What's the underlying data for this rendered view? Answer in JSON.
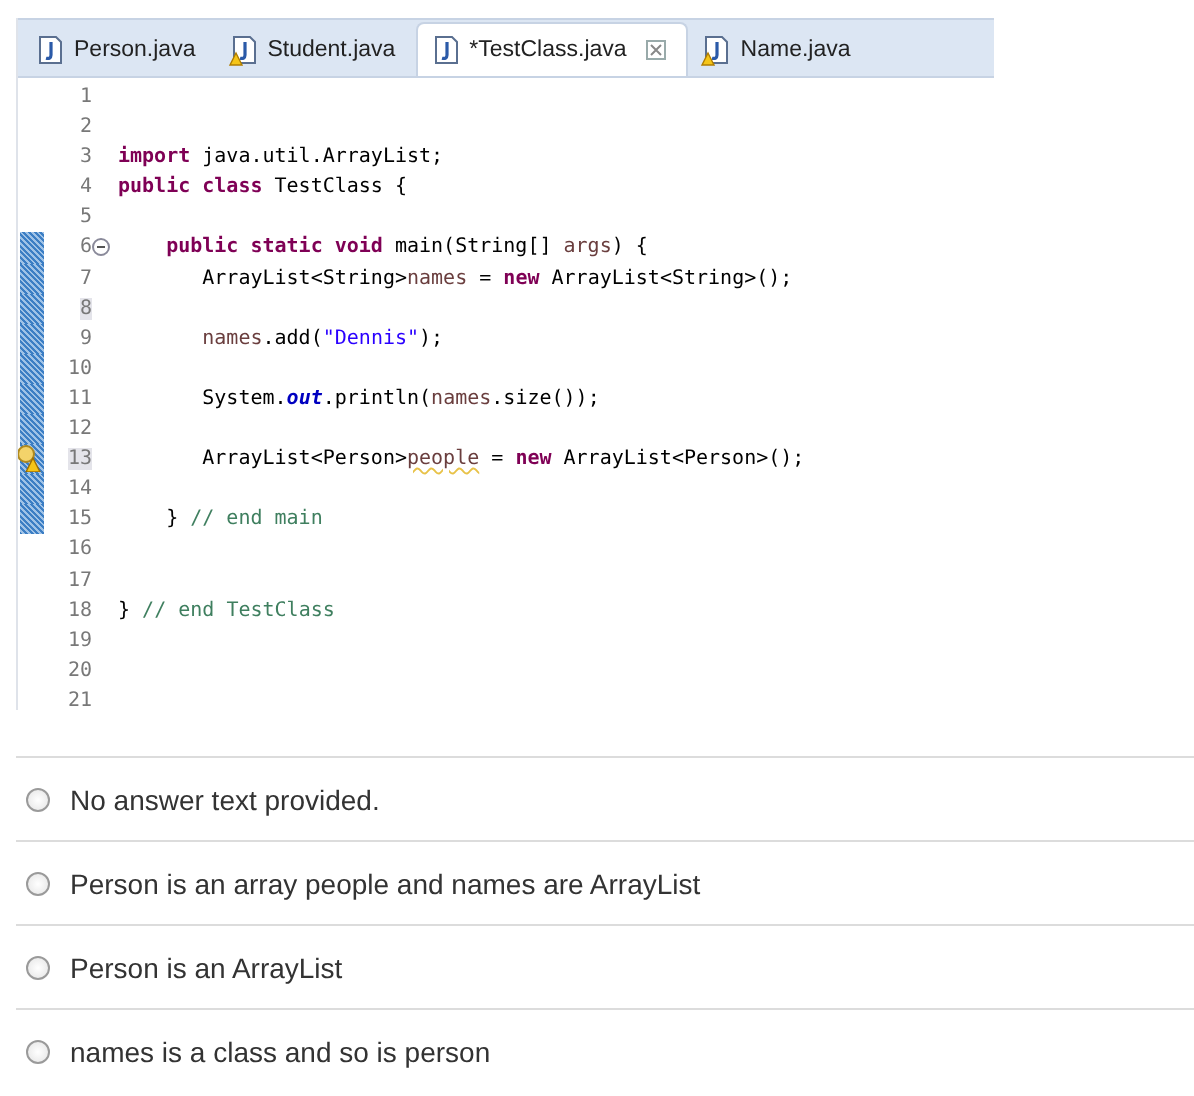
{
  "editor": {
    "tabs": [
      {
        "label": "Person.java",
        "selected": false,
        "warning": false,
        "closable": false
      },
      {
        "label": "Student.java",
        "selected": false,
        "warning": true,
        "closable": false
      },
      {
        "label": "*TestClass.java",
        "selected": true,
        "warning": false,
        "closable": true
      },
      {
        "label": "Name.java",
        "selected": false,
        "warning": true,
        "closable": false
      }
    ],
    "lines": [
      {
        "number": "1",
        "changed": false,
        "fold": false,
        "warning": false,
        "current": false
      },
      {
        "number": "2",
        "changed": false,
        "fold": false,
        "warning": false,
        "current": false
      },
      {
        "number": "3",
        "changed": false,
        "fold": false,
        "warning": false,
        "current": false,
        "tokens": [
          {
            "kind": "keyword",
            "text": "import"
          },
          {
            "kind": "plain",
            "text": " java.util.ArrayList;"
          }
        ]
      },
      {
        "number": "4",
        "changed": false,
        "fold": false,
        "warning": false,
        "current": false,
        "tokens": [
          {
            "kind": "keyword",
            "text": "public class"
          },
          {
            "kind": "plain",
            "text": " TestClass {"
          }
        ]
      },
      {
        "number": "5",
        "changed": false,
        "fold": false,
        "warning": false,
        "current": false
      },
      {
        "number": "6",
        "changed": true,
        "fold": true,
        "warning": false,
        "current": false,
        "tokens": [
          {
            "kind": "keyword",
            "text": "    public static void"
          },
          {
            "kind": "plain",
            "text": " main(String[] "
          },
          {
            "kind": "param",
            "text": "args"
          },
          {
            "kind": "plain",
            "text": ") {"
          }
        ]
      },
      {
        "number": "7",
        "changed": true,
        "fold": false,
        "warning": false,
        "current": false,
        "tokens": [
          {
            "kind": "plain",
            "text": "       ArrayList<String>"
          },
          {
            "kind": "local",
            "text": "names"
          },
          {
            "kind": "plain",
            "text": " = "
          },
          {
            "kind": "keyword",
            "text": "new"
          },
          {
            "kind": "plain",
            "text": " ArrayList<String>();"
          }
        ]
      },
      {
        "number": "8",
        "changed": true,
        "fold": false,
        "warning": false,
        "current": true
      },
      {
        "number": "9",
        "changed": true,
        "fold": false,
        "warning": false,
        "current": false,
        "tokens": [
          {
            "kind": "local",
            "text": "       names"
          },
          {
            "kind": "plain",
            "text": ".add("
          },
          {
            "kind": "string",
            "text": "\"Dennis\""
          },
          {
            "kind": "plain",
            "text": ");"
          }
        ]
      },
      {
        "number": "10",
        "changed": true,
        "fold": false,
        "warning": false,
        "current": false
      },
      {
        "number": "11",
        "changed": true,
        "fold": false,
        "warning": false,
        "current": false,
        "tokens": [
          {
            "kind": "plain",
            "text": "       System."
          },
          {
            "kind": "field",
            "text": "out"
          },
          {
            "kind": "plain",
            "text": ".println("
          },
          {
            "kind": "local",
            "text": "names"
          },
          {
            "kind": "plain",
            "text": ".size());"
          }
        ]
      },
      {
        "number": "12",
        "changed": true,
        "fold": false,
        "warning": false,
        "current": false
      },
      {
        "number": "13",
        "changed": true,
        "fold": false,
        "warning": true,
        "current": true,
        "tokens": [
          {
            "kind": "plain",
            "text": "       ArrayList<Person>"
          },
          {
            "kind": "unused",
            "text": "people"
          },
          {
            "kind": "plain",
            "text": " = "
          },
          {
            "kind": "keyword",
            "text": "new"
          },
          {
            "kind": "plain",
            "text": " ArrayList<Person>();"
          }
        ]
      },
      {
        "number": "14",
        "changed": true,
        "fold": false,
        "warning": false,
        "current": false
      },
      {
        "number": "15",
        "changed": true,
        "fold": false,
        "warning": false,
        "current": false,
        "tokens": [
          {
            "kind": "plain",
            "text": "    } "
          },
          {
            "kind": "comment",
            "text": "// end main"
          }
        ]
      },
      {
        "number": "16",
        "changed": false,
        "fold": false,
        "warning": false,
        "current": false
      },
      {
        "number": "17",
        "changed": false,
        "fold": false,
        "warning": false,
        "current": false
      },
      {
        "number": "18",
        "changed": false,
        "fold": false,
        "warning": false,
        "current": false,
        "tokens": [
          {
            "kind": "plain",
            "text": "} "
          },
          {
            "kind": "comment",
            "text": "// end TestClass"
          }
        ]
      },
      {
        "number": "19",
        "changed": false,
        "fold": false,
        "warning": false,
        "current": false
      },
      {
        "number": "20",
        "changed": false,
        "fold": false,
        "warning": false,
        "current": false
      },
      {
        "number": "21",
        "changed": false,
        "fold": false,
        "warning": false,
        "current": false
      }
    ]
  },
  "answers": [
    {
      "label": "No answer text provided.",
      "selected": false
    },
    {
      "label": "Person is an array people and names are ArrayList",
      "selected": false
    },
    {
      "label": "Person is an ArrayList",
      "selected": false
    },
    {
      "label": "names is a class and so is person",
      "selected": false
    }
  ]
}
